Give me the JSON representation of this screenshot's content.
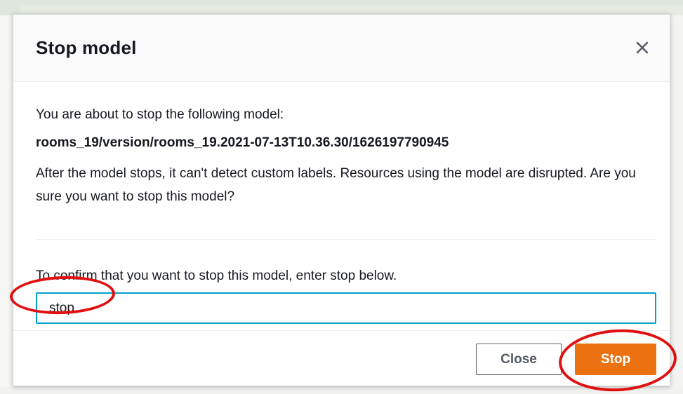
{
  "modal": {
    "title": "Stop model",
    "intro": "You are about to stop the following model:",
    "model_id": "rooms_19/version/rooms_19.2021-07-13T10.36.30/1626197790945",
    "warning": "After the model stops, it can't detect custom labels. Resources using the model are disrupted. Are you sure you want to stop this model?",
    "confirm_label": "To confirm that you want to stop this model, enter stop below.",
    "confirm_input": {
      "value": "stop"
    },
    "close_icon": "close-icon",
    "buttons": {
      "close_label": "Close",
      "stop_label": "Stop"
    }
  },
  "colors": {
    "primary_button": "#ec7211",
    "input_focus_border": "#00a1c9",
    "annotation": "#e01010"
  }
}
